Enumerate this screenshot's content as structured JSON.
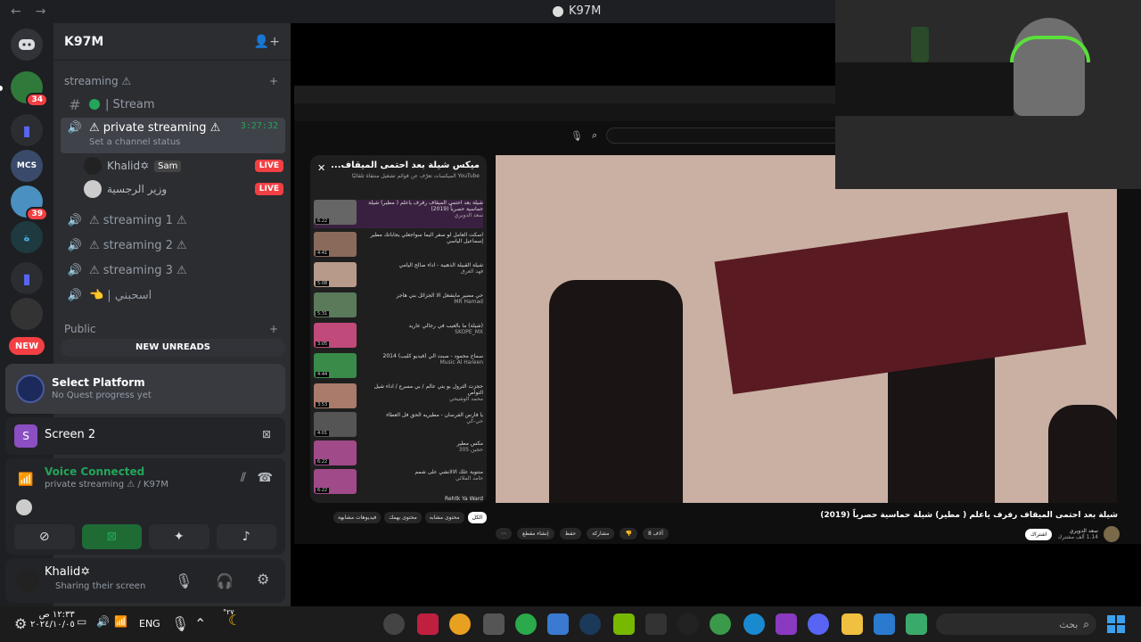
{
  "window": {
    "title": "K97M"
  },
  "servers": {
    "badges": [
      "34",
      "39"
    ],
    "new_label": "NEW"
  },
  "guild": {
    "name": "K97M"
  },
  "categories": {
    "streaming": "streaming ⚠",
    "public": "Public"
  },
  "channels": {
    "stream": "| Stream",
    "private_streaming": "⚠ private streaming ⚠",
    "private_status": "Set a channel status",
    "private_timer": "3:27:32",
    "streaming1": "⚠ streaming 1 ⚠",
    "streaming2": "⚠ streaming 2 ⚠",
    "streaming3": "⚠ streaming 3 ⚠",
    "ashibni": "| اسحبني"
  },
  "voice_users": [
    {
      "name": "Khalid✡",
      "tag": "Sam",
      "live": "LIVE"
    },
    {
      "name": "وزير الرجسية",
      "live": "LIVE"
    }
  ],
  "new_unreads": "NEW UNREADS",
  "quest": {
    "title": "Select Platform",
    "subtitle": "No Quest progress yet"
  },
  "screen": {
    "initial": "S",
    "label": "Screen 2"
  },
  "voice": {
    "status": "Voice Connected",
    "location": "private streaming ⚠ / K97M"
  },
  "user": {
    "name": "Khalid✡",
    "status": "Sharing their screen"
  },
  "youtube": {
    "playlist_title": "ميكس شيلة بعد احتمى الميقاف...",
    "playlist_sub": "YouTube الميكسات تعرّف عن قوائم تشغيل منتقاة تلقائيًا",
    "video_title": "شيلة بعد احتمى الميقاف رفرف ياعلم ( مطير) شيلة حماسية حصرياً (2019)",
    "channel": "سعد الدويري",
    "subscribers": "1.14 ألف مشترك",
    "subscribe": "اشتراك",
    "likes": "8 آلاف",
    "share": "مشاركة",
    "save": "حفظ",
    "clip": "إنشاء مقطع",
    "playlist_items": [
      {
        "title": "شيلة بعد احتمى الميقاف رفرف ياعلم ( مطير) شيلة حماسية حصرياً (2019)",
        "author": "سعد الدويري",
        "duration": "6:22"
      },
      {
        "title": "اسكت العامل لو سفر اليما سواجعلي يجاباتك مطير إسماعيل الياسي",
        "author": "",
        "duration": "4:41"
      },
      {
        "title": "شيلة القبيلة الذهبية - اداء صالح اليامي",
        "author": "فهد العرق",
        "duration": "5:08"
      },
      {
        "title": "حي مضير مايشغل الا الجزائل بني هاجر",
        "author": "MR Hamad",
        "duration": "5:31"
      },
      {
        "title": "(شيلة) ما بالعيب في رجالي عاريد",
        "author": "SKOPE_MX",
        "duration": "3:05"
      },
      {
        "title": "سماح محمود - صبت الي (فيديو كليب) 2014",
        "author": "Music Al Hareen",
        "duration": "4:44"
      },
      {
        "title": "حجزت الترول بو يتي عالم / بي مسرع / اداء شيل التواص",
        "author": "محمد الوشيحي",
        "duration": "3:53"
      },
      {
        "title": "يا فارس الفرسان - مطيريه الحق فل العطاء",
        "author": "حي-كي",
        "duration": "4:01"
      },
      {
        "title": "مكس مطير",
        "author": "حجين 305",
        "duration": "6:22"
      },
      {
        "title": "منتوية علك الالانشي على شمم",
        "author": "حامد الملائي",
        "duration": "6:22"
      },
      {
        "title": "Rehtk Ya Ward",
        "author": "",
        "duration": ""
      }
    ],
    "chips": [
      "الكل",
      "محتوى مشابه",
      "محتوى يهمك",
      "فيديوهات مشابهة"
    ]
  },
  "taskbar": {
    "time": "١٢:٣٣ ص",
    "date": "٢٠٢٤/١٠/٠٥",
    "lang": "ENG",
    "search_placeholder": "بحث",
    "temp": "°٢٧"
  }
}
